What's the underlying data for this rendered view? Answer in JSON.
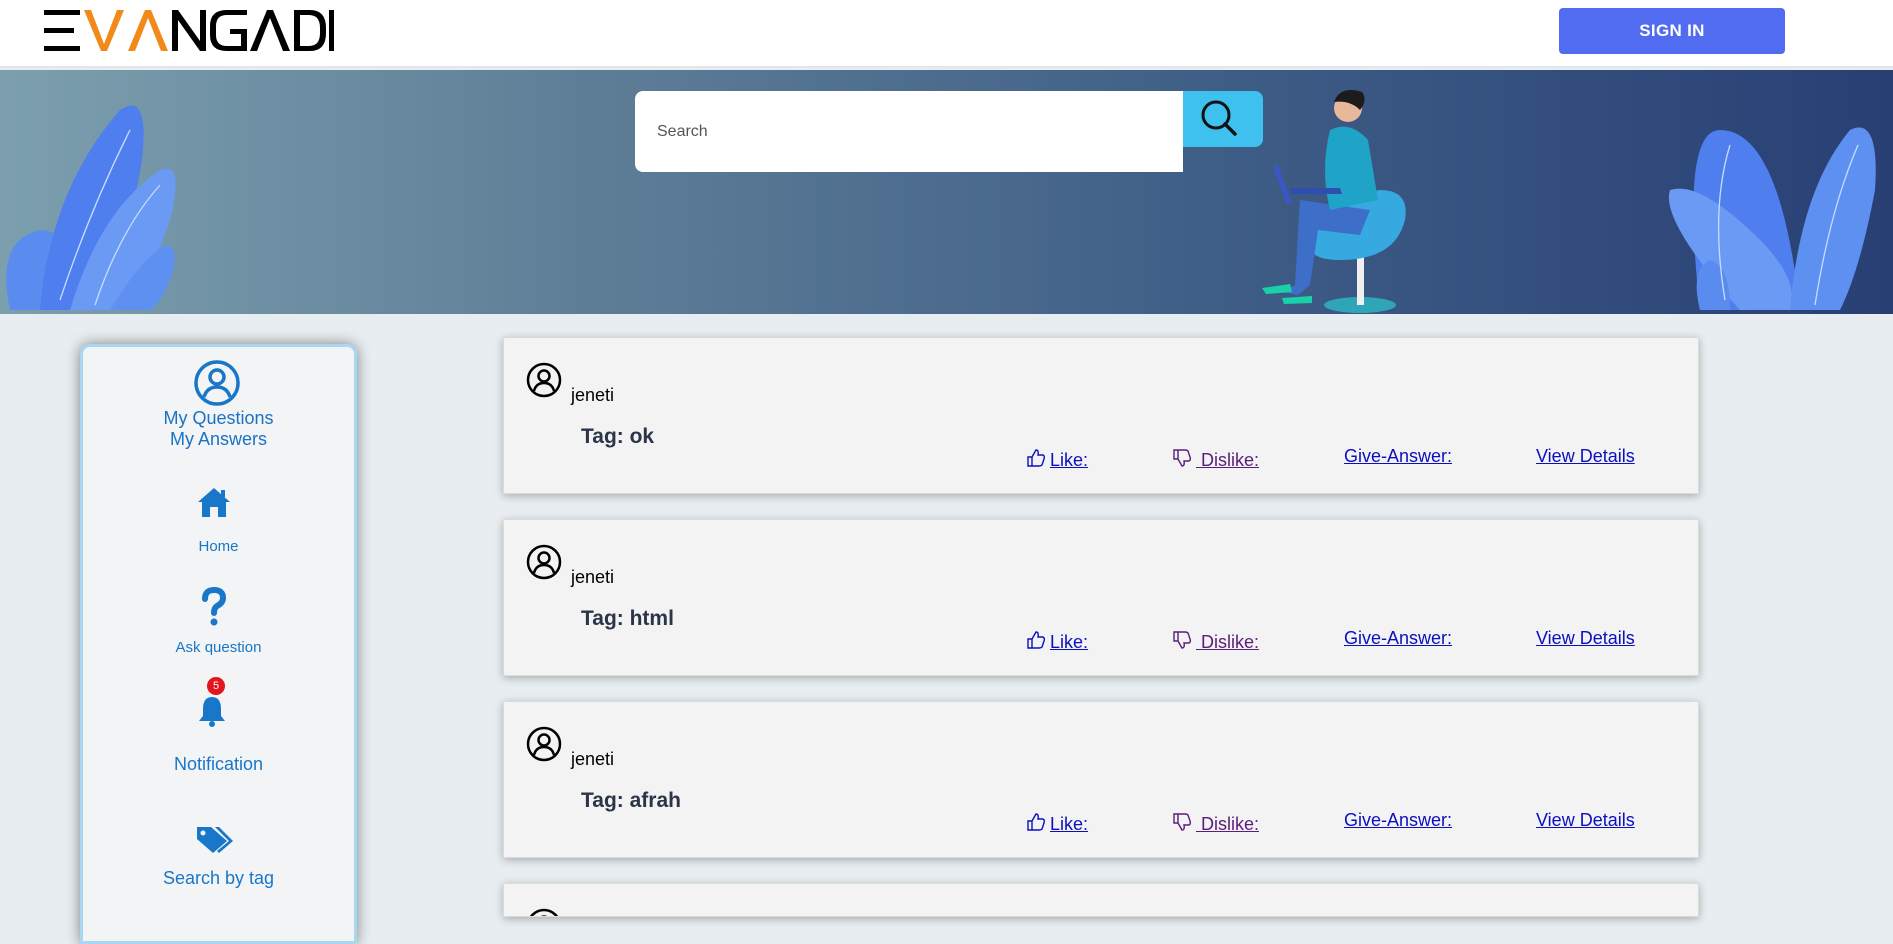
{
  "header": {
    "logo_text": "EVANGADI",
    "signin_label": "SIGN IN"
  },
  "search": {
    "placeholder": "Search"
  },
  "sidebar": {
    "my_questions": "My Questions",
    "my_answers": "My Answers",
    "home": "Home",
    "ask_question": "Ask question",
    "notification": "Notification",
    "notification_count": "5",
    "search_by_tag": "Search by tag"
  },
  "questions": [
    {
      "user": "jeneti",
      "tag_prefix": "Tag: ",
      "tag": "ok",
      "like": "Like:",
      "dislike": " Dislike:",
      "give_answer": "Give-Answer:",
      "view_details": "View Details"
    },
    {
      "user": "jeneti",
      "tag_prefix": "Tag: ",
      "tag": "html",
      "like": "Like:",
      "dislike": " Dislike:",
      "give_answer": "Give-Answer:",
      "view_details": "View Details"
    },
    {
      "user": "jeneti",
      "tag_prefix": "Tag: ",
      "tag": "afrah",
      "like": "Like:",
      "dislike": " Dislike:",
      "give_answer": "Give-Answer:",
      "view_details": "View Details"
    }
  ],
  "colors": {
    "accent": "#516cf0",
    "search_button": "#3fc1ef",
    "sidebar_link": "#1877c9",
    "notification_badge": "#e3151e"
  }
}
